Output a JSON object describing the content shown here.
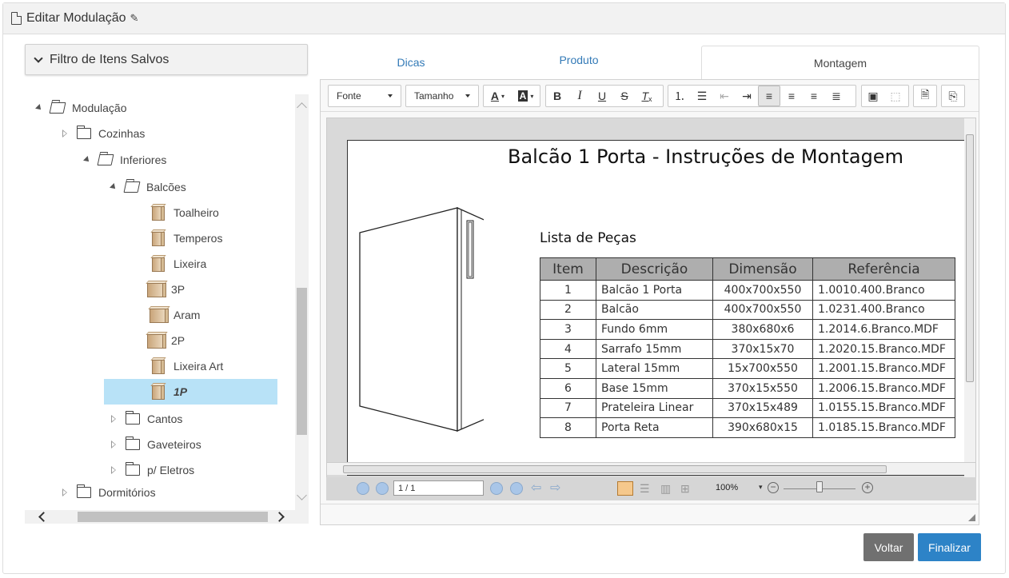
{
  "header": {
    "title": "Editar Modulação"
  },
  "filter": {
    "label": "Filtro de Itens Salvos"
  },
  "tree": {
    "nodes": [
      {
        "label": "Modulação"
      },
      {
        "label": "Cozinhas"
      },
      {
        "label": "Inferiores"
      },
      {
        "label": "Balcões"
      },
      {
        "label": "Toalheiro"
      },
      {
        "label": "Temperos"
      },
      {
        "label": "Lixeira"
      },
      {
        "label": "3P"
      },
      {
        "label": "Aram"
      },
      {
        "label": "2P"
      },
      {
        "label": "Lixeira Art"
      },
      {
        "label": "1P"
      },
      {
        "label": "Cantos"
      },
      {
        "label": "Gaveteiros"
      },
      {
        "label": "p/ Eletros"
      },
      {
        "label": "Dormitórios"
      }
    ],
    "selected": "1P"
  },
  "tabs": [
    {
      "label": "Dicas"
    },
    {
      "label": "Produto"
    },
    {
      "label": "Montagem"
    }
  ],
  "active_tab": "Montagem",
  "toolbar": {
    "font_label": "Fonte",
    "size_label": "Tamanho"
  },
  "document": {
    "title": "Balcão 1 Porta - Instruções de Montagem",
    "list_title": "Lista de Peças",
    "columns": [
      "Item",
      "Descrição",
      "Dimensão",
      "Referência"
    ],
    "rows": [
      [
        "1",
        "Balcão 1 Porta",
        "400x700x550",
        "1.0010.400.Branco"
      ],
      [
        "2",
        "Balcão",
        "400x700x550",
        "1.0231.400.Branco"
      ],
      [
        "3",
        "Fundo 6mm",
        "380x680x6",
        "1.2014.6.Branco.MDF"
      ],
      [
        "4",
        "Sarrafo 15mm",
        "370x15x70",
        "1.2020.15.Branco.MDF"
      ],
      [
        "5",
        "Lateral 15mm",
        "15x700x550",
        "1.2001.15.Branco.MDF"
      ],
      [
        "6",
        "Base 15mm",
        "370x15x550",
        "1.2006.15.Branco.MDF"
      ],
      [
        "7",
        "Prateleira Linear",
        "370x15x489",
        "1.0155.15.Branco.MDF"
      ],
      [
        "8",
        "Porta Reta",
        "390x680x15",
        "1.0185.15.Branco.MDF"
      ]
    ]
  },
  "viewer": {
    "page": "1 / 1",
    "zoom": "100%"
  },
  "buttons": {
    "back": "Voltar",
    "finish": "Finalizar"
  },
  "colors": {
    "primary": "#2d83c7",
    "secondary": "#707070",
    "selection": "#b8e2f7",
    "link": "#337ab7"
  }
}
